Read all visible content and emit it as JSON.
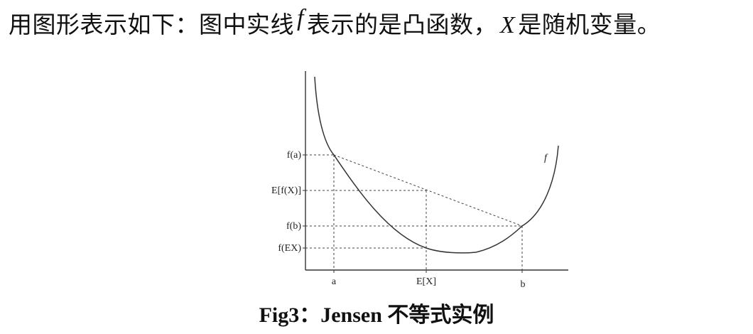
{
  "intro": {
    "text_before": "用图形表示如下：图中实线",
    "f_symbol": "f",
    "text_middle": "表示的是凸函数，",
    "x_symbol": "X",
    "text_after": "是随机变量。"
  },
  "plot": {
    "curve_label": "f",
    "y_labels": {
      "fa": "f(a)",
      "efx": "E[f(X)]",
      "fb": "f(b)",
      "fex": "f(EX)"
    },
    "x_labels": {
      "a": "a",
      "ex": "E[X]",
      "b": "b"
    },
    "colors": {
      "curve": "#333333",
      "guides": "#444444"
    }
  },
  "caption": {
    "prefix": "Fig3：",
    "text": "Jensen 不等式实例"
  }
}
